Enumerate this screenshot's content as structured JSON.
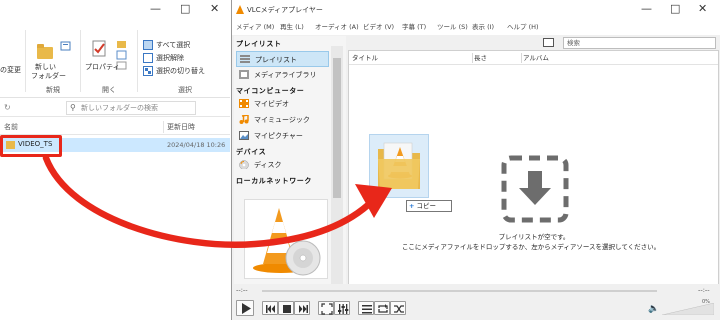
{
  "explorer": {
    "ribbon": {
      "organize_label": "の変更",
      "new_folder_label_1": "新しい",
      "new_folder_label_2": "フォルダー",
      "group_new": "新規",
      "properties_label": "プロパティ",
      "group_open": "開く",
      "select_all": "すべて選択",
      "select_none": "選択解除",
      "invert_select": "選択の切り替え",
      "group_select": "選択"
    },
    "search_placeholder": "新しいフォルダーの検索",
    "columns": {
      "name": "名前",
      "date": "更新日時"
    },
    "files": [
      {
        "name": "VIDEO_TS",
        "date": "2024/04/18 10:26"
      }
    ]
  },
  "vlc": {
    "title": "VLCメディアプレイヤー",
    "menu": [
      "メディア (M)",
      "再生 (L)",
      "オーディオ (A)",
      "ビデオ (V)",
      "字幕 (T)",
      "ツール (S)",
      "表示 (I)",
      "ヘルプ (H)"
    ],
    "sidebar": {
      "playlist_section": "プレイリスト",
      "playlist_item": "プレイリスト",
      "library_item": "メディアライブラリ",
      "my_computer_section": "マイコンピューター",
      "my_videos": "マイビデオ",
      "my_music": "マイミュージック",
      "my_pictures": "マイピクチャー",
      "devices_section": "デバイス",
      "disc": "ディスク",
      "lan_section": "ローカルネットワーク"
    },
    "search_placeholder": "検索",
    "columns": {
      "title": "タイトル",
      "duration": "長さ",
      "album": "アルバム"
    },
    "empty_line1": "プレイリストが空です。",
    "empty_line2": "ここにメディアファイルをドロップするか、左からメディアソースを選択してください。",
    "copy_tooltip": "コピー",
    "copy_plus": "+",
    "time_elapsed": "--:--",
    "time_total": "--:--",
    "volume": "0%"
  },
  "colors": {
    "arrow": "#e8271a",
    "selection": "#cce8ff",
    "vlc_orange": "#f08a00"
  }
}
